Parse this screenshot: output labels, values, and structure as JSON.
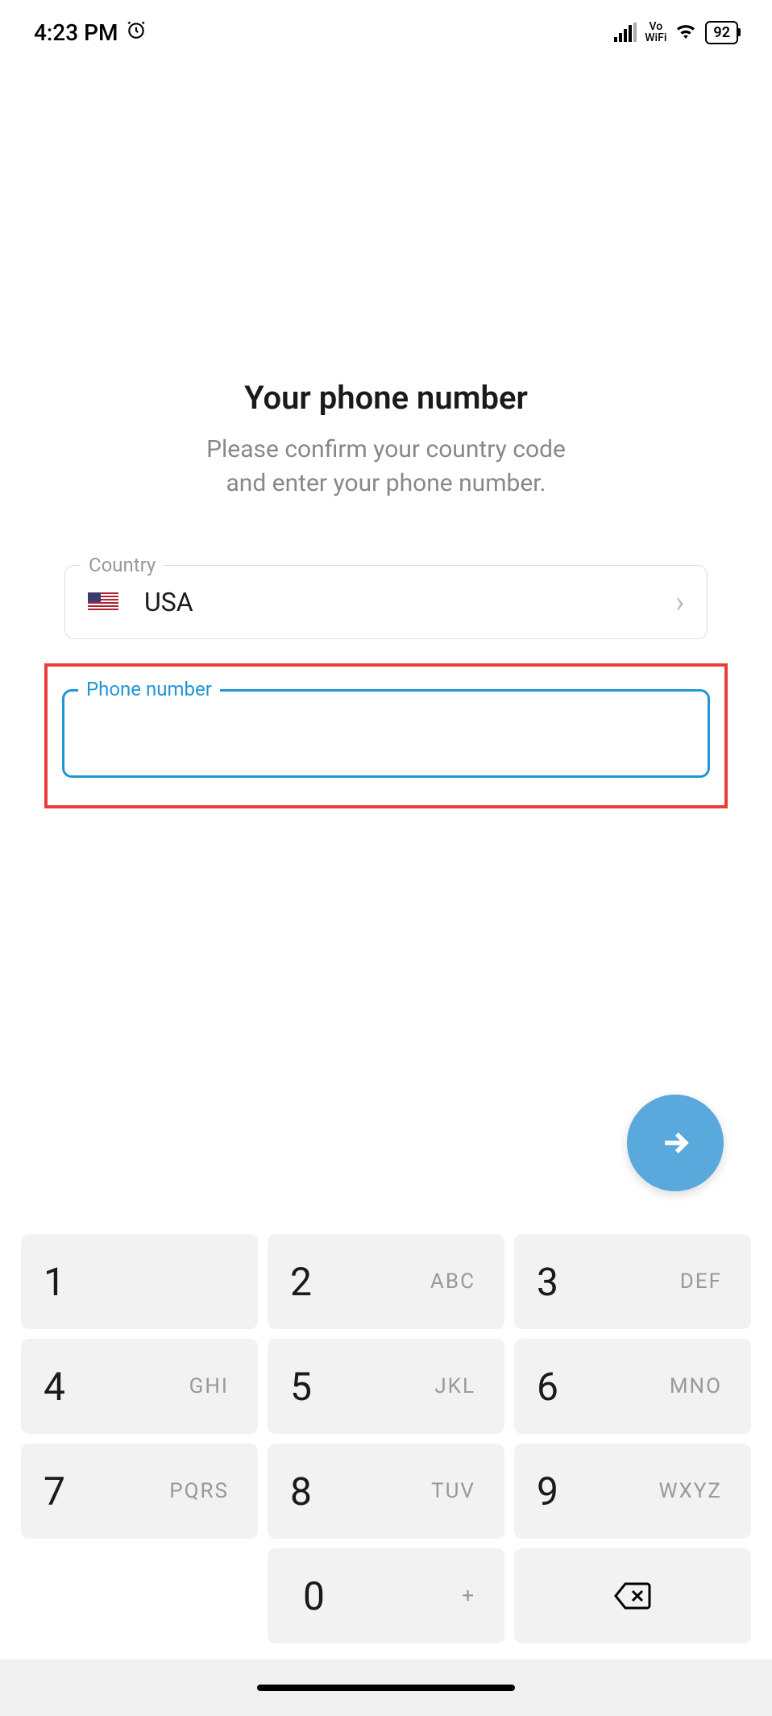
{
  "statusBar": {
    "time": "4:23 PM",
    "vowifi_top": "Vo",
    "vowifi_bottom": "WiFi",
    "battery": "92"
  },
  "page": {
    "title": "Your phone number",
    "subtitle_line1": "Please confirm your country code",
    "subtitle_line2": "and enter your phone number."
  },
  "fields": {
    "country_label": "Country",
    "country_value": "USA",
    "phone_label": "Phone number",
    "phone_value": ""
  },
  "keypad": {
    "k1": {
      "num": "1",
      "letters": ""
    },
    "k2": {
      "num": "2",
      "letters": "ABC"
    },
    "k3": {
      "num": "3",
      "letters": "DEF"
    },
    "k4": {
      "num": "4",
      "letters": "GHI"
    },
    "k5": {
      "num": "5",
      "letters": "JKL"
    },
    "k6": {
      "num": "6",
      "letters": "MNO"
    },
    "k7": {
      "num": "7",
      "letters": "PQRS"
    },
    "k8": {
      "num": "8",
      "letters": "TUV"
    },
    "k9": {
      "num": "9",
      "letters": "WXYZ"
    },
    "k0": {
      "num": "0",
      "letters": "+"
    }
  }
}
